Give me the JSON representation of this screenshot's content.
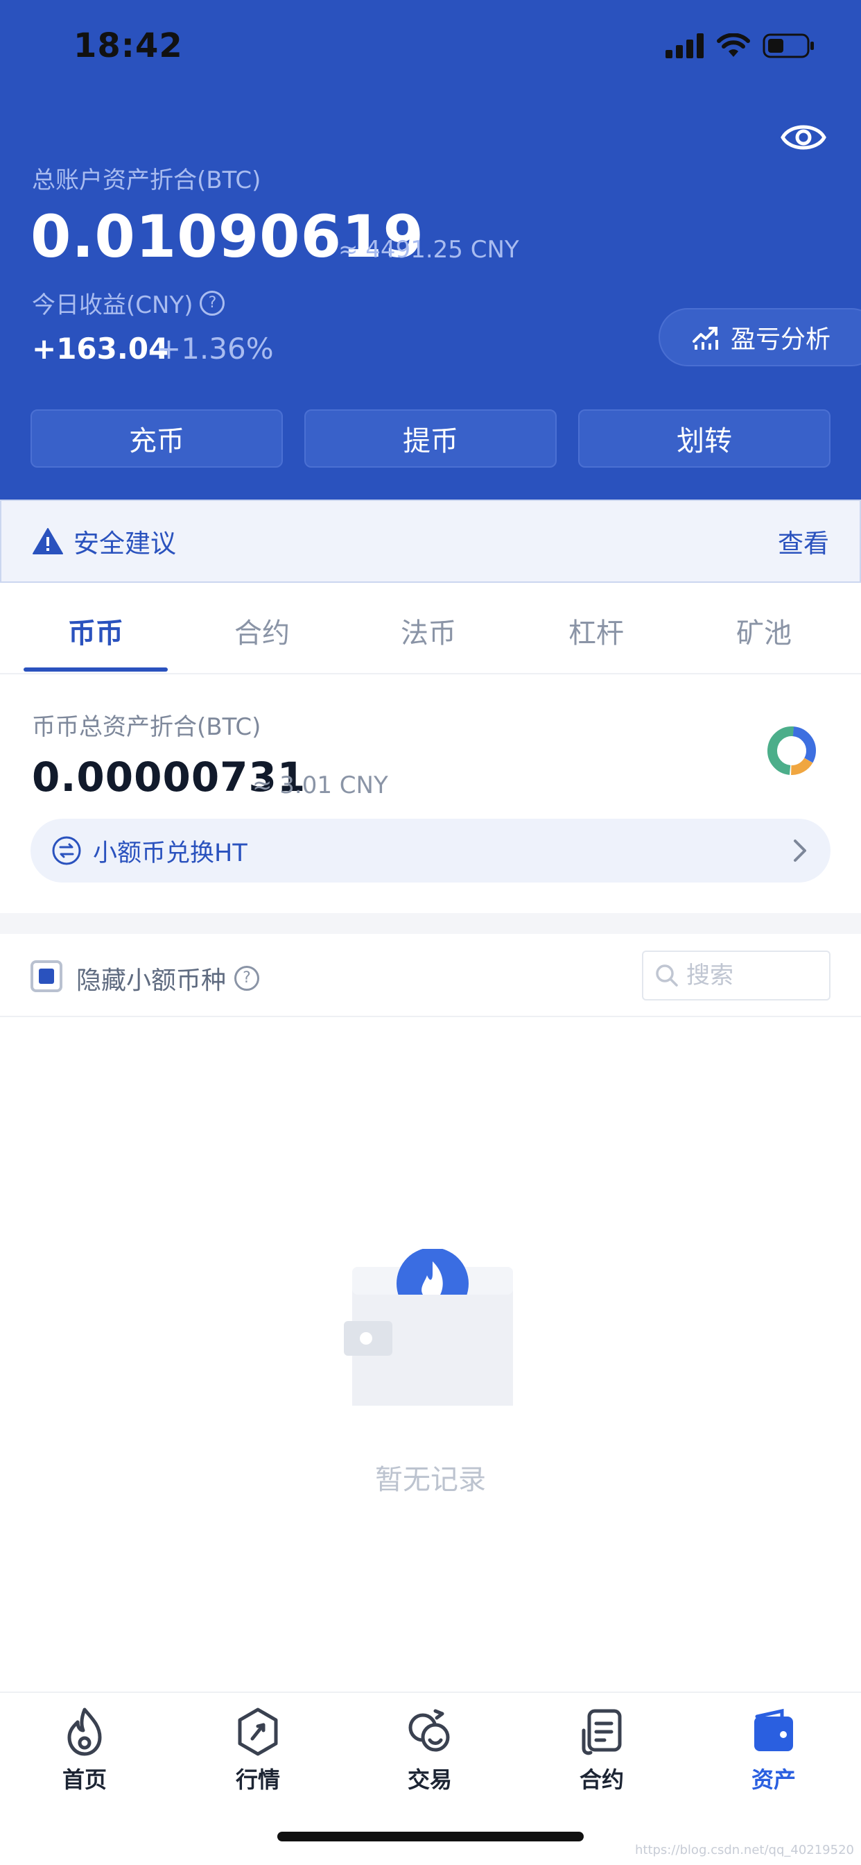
{
  "status_bar": {
    "time": "18:42"
  },
  "header": {
    "total_label": "总账户资产折合(BTC)",
    "total_value": "0.01090619",
    "total_cny": "≈ 4491.25 CNY",
    "profit_label": "今日收益(CNY)",
    "profit_value": "+163.04",
    "profit_pct": "+1.36%",
    "pnl_button": "盈亏分析",
    "actions": [
      "充币",
      "提币",
      "划转"
    ]
  },
  "security": {
    "label": "安全建议",
    "view": "查看"
  },
  "tabs": [
    "币币",
    "合约",
    "法币",
    "杠杆",
    "矿池"
  ],
  "active_tab": 0,
  "spot": {
    "label": "币币总资产折合(BTC)",
    "value": "0.00000731",
    "cny": "≈ 3.01 CNY",
    "convert_label": "小额币兑换HT"
  },
  "filter": {
    "hide_label": "隐藏小额币种",
    "hide_checked": true,
    "search_placeholder": "搜索"
  },
  "empty_text": "暂无记录",
  "nav": {
    "items": [
      "首页",
      "行情",
      "交易",
      "合约",
      "资产"
    ],
    "active": 4
  },
  "watermark": "https://blog.csdn.net/qq_40219520",
  "colors": {
    "brand": "#2a52be",
    "nav_active": "#2a5fe0"
  }
}
